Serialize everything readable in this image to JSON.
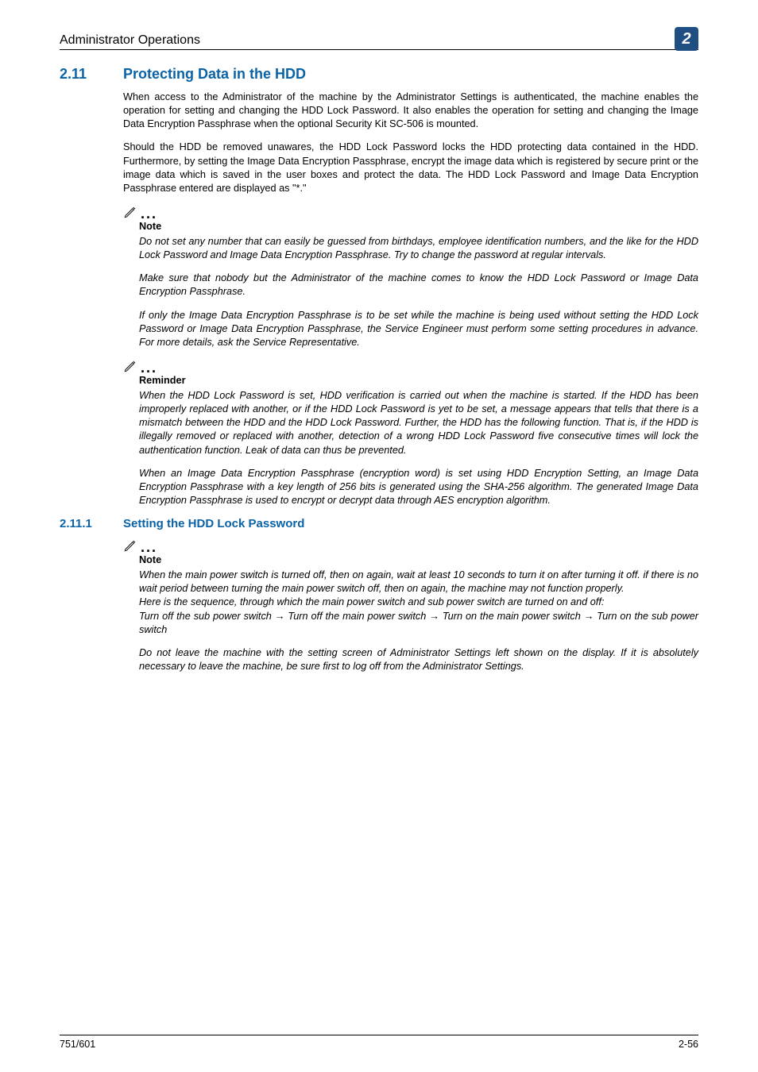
{
  "header": {
    "running_title": "Administrator Operations",
    "chapter_number": "2"
  },
  "section": {
    "number": "2.11",
    "title": "Protecting Data in the HDD",
    "para1": "When access to the Administrator of the machine by the Administrator Settings is authenticated, the machine enables the operation for setting and changing the HDD Lock Password. It also enables the operation for setting and changing the Image Data Encryption Passphrase when the optional Security Kit SC-506 is mounted.",
    "para2": "Should the HDD be removed unawares, the HDD Lock Password locks the HDD protecting data contained in the HDD. Furthermore, by setting the Image Data Encryption Passphrase, encrypt the image data which is registered by secure print or the image data which is saved in the user boxes and protect the data. The HDD Lock Password and Image Data Encryption Passphrase entered are displayed as \"*.\""
  },
  "note1": {
    "label": "Note",
    "p1": "Do not set any number that can easily be guessed from birthdays, employee identification numbers, and the like for the HDD Lock Password and Image Data Encryption Passphrase. Try to change the password at regular intervals.",
    "p2": "Make sure that nobody but the Administrator of the machine comes to know the HDD Lock Password or Image Data Encryption Passphrase.",
    "p3": "If only the Image Data Encryption Passphrase is to be set while the machine is being used without setting the HDD Lock Password or Image Data Encryption Passphrase, the Service Engineer must perform some setting procedures in advance. For more details, ask the Service Representative."
  },
  "reminder": {
    "label": "Reminder",
    "p1": "When the HDD Lock Password is set, HDD verification is carried out when the machine is started. If the HDD has been improperly replaced with another, or if the HDD Lock Password is yet to be set, a message appears that tells that there is a mismatch between the HDD and the HDD Lock Password. Further, the HDD has the following function. That is, if the HDD is illegally removed or replaced with another, detection of a wrong HDD Lock Password five consecutive times will lock the authentication function. Leak of data can thus be prevented.",
    "p2": "When an Image Data Encryption Passphrase (encryption word) is set using HDD Encryption Setting, an Image Data Encryption Passphrase with a key length of 256 bits is generated using the SHA-256 algorithm. The generated Image Data Encryption Passphrase is used to encrypt or decrypt data through AES encryption algorithm."
  },
  "subsection": {
    "number": "2.11.1",
    "title": "Setting the HDD Lock Password"
  },
  "note2": {
    "label": "Note",
    "p1": "When the main power switch is turned off, then on again, wait at least 10 seconds to turn it on after turning it off. if there is no wait period between turning the main power switch off, then on again, the machine may not function properly.",
    "p2": "Here is the sequence, through which the main power switch and sub power switch are turned on and off:",
    "p3_a": "Turn off the sub power switch ",
    "p3_b": " Turn off the main power switch ",
    "p3_c": " Turn on the main power switch ",
    "p3_d": " Turn on the sub power switch",
    "p4": "Do not leave the machine with the setting screen of Administrator Settings left shown on the display. If it is absolutely necessary to leave the machine, be sure first to log off from the Administrator Settings."
  },
  "footer": {
    "left": "751/601",
    "right": "2-56"
  },
  "glyphs": {
    "arrow": "→"
  }
}
